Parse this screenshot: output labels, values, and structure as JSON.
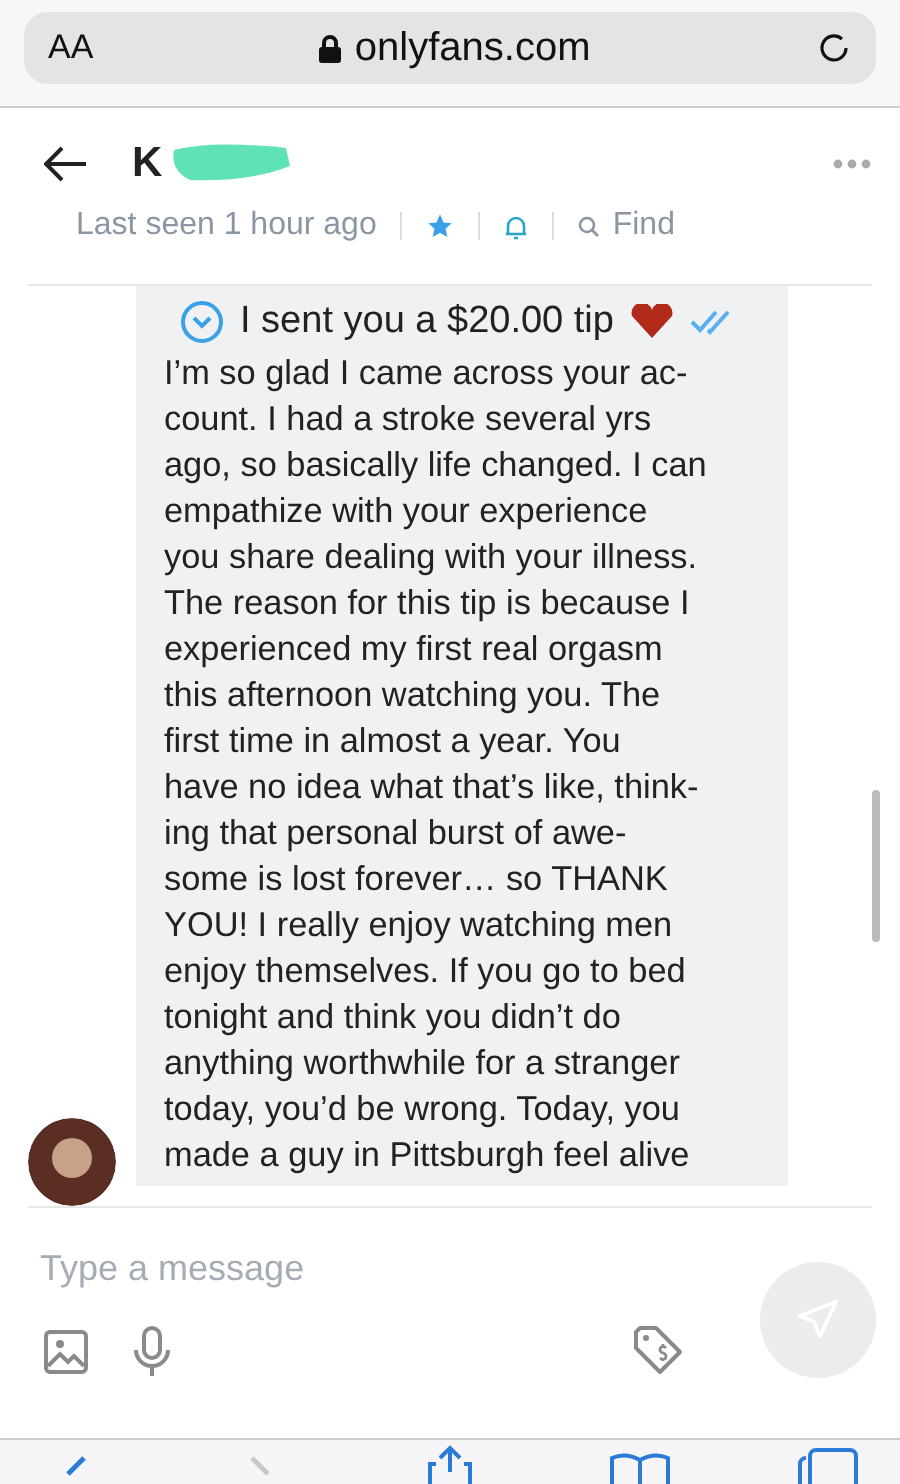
{
  "browser": {
    "text_size": "AA",
    "url": "onlyfans.com"
  },
  "header": {
    "name": "K",
    "status": "Last seen 1 hour ago",
    "favorite": true,
    "find": "Find"
  },
  "message": {
    "tip": "I sent you a $20.00 tip",
    "lines": [
      "I’m so glad I came across your ac-",
      "count. I had a stroke several yrs",
      "ago, so basically life changed. I can",
      "empathize with your experience",
      "you share dealing with your illness.",
      "The reason for this tip is because I",
      "experienced my first real orgasm",
      "this afternoon watching you. The",
      "first time in almost a year. You",
      "have no idea what that’s like, think-",
      "ing that personal burst of awe-",
      "some is lost forever… so THANK",
      "YOU! I really enjoy watching men",
      "enjoy themselves. If you go to bed",
      "tonight and think you didn’t do",
      "anything worthwhile for a stranger",
      "today, you’d be wrong. Today, you",
      "made a guy in Pittsburgh feel alive"
    ]
  },
  "composer": {
    "placeholder": "Type a message"
  }
}
